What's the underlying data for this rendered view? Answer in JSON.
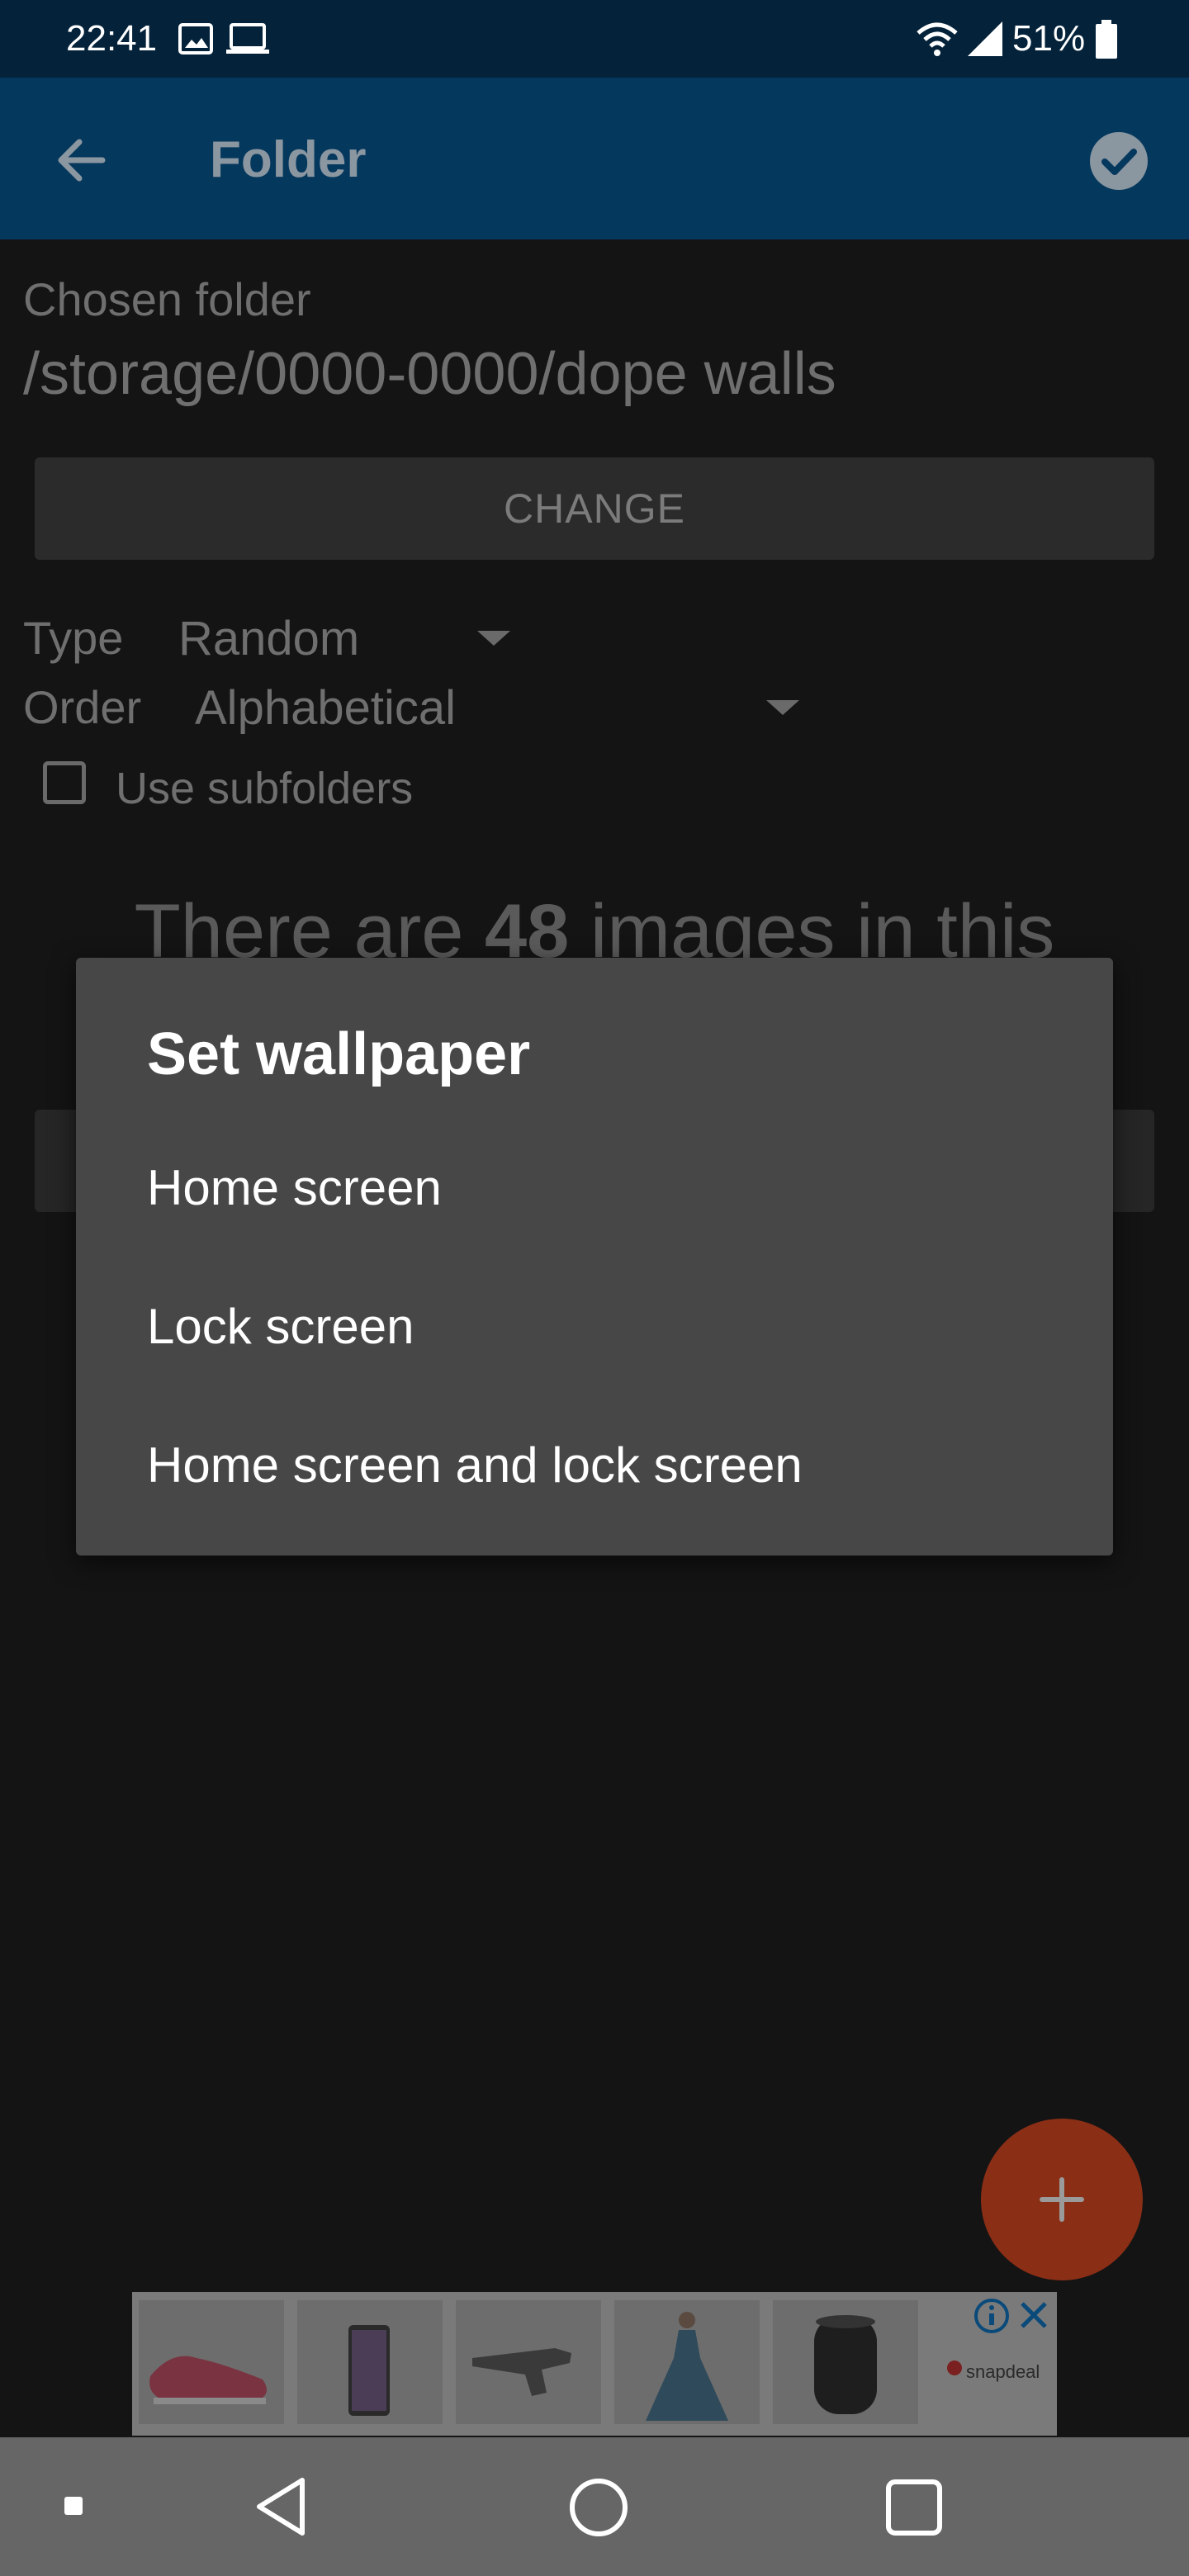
{
  "status_bar": {
    "time": "22:41",
    "battery_percent": "51%",
    "icons": [
      "image-icon",
      "laptop-icon",
      "wifi-icon",
      "signal-icon",
      "battery-icon"
    ]
  },
  "app_bar": {
    "title": "Folder",
    "back_icon": "arrow-back-icon",
    "confirm_icon": "check-circle-icon"
  },
  "folder": {
    "chosen_label": "Chosen folder",
    "chosen_path": "/storage/0000-0000/dope walls",
    "change_button": "CHANGE"
  },
  "settings": {
    "type_label": "Type",
    "type_value": "Random",
    "order_label": "Order",
    "order_value": "Alphabetical",
    "subfolders_label": "Use subfolders",
    "subfolders_checked": false
  },
  "summary": {
    "prefix": "There are ",
    "count": "48",
    "suffix": " images in this"
  },
  "dialog": {
    "title": "Set wallpaper",
    "options": [
      "Home screen",
      "Lock screen",
      "Home screen and lock screen"
    ]
  },
  "fab": {
    "icon": "plus-icon"
  },
  "ad": {
    "brand": "snapdeal"
  },
  "colors": {
    "status_bar": "#04223a",
    "app_bar": "#05385d",
    "background": "#141414",
    "dialog": "#474747",
    "fab": "#8a2e16"
  }
}
